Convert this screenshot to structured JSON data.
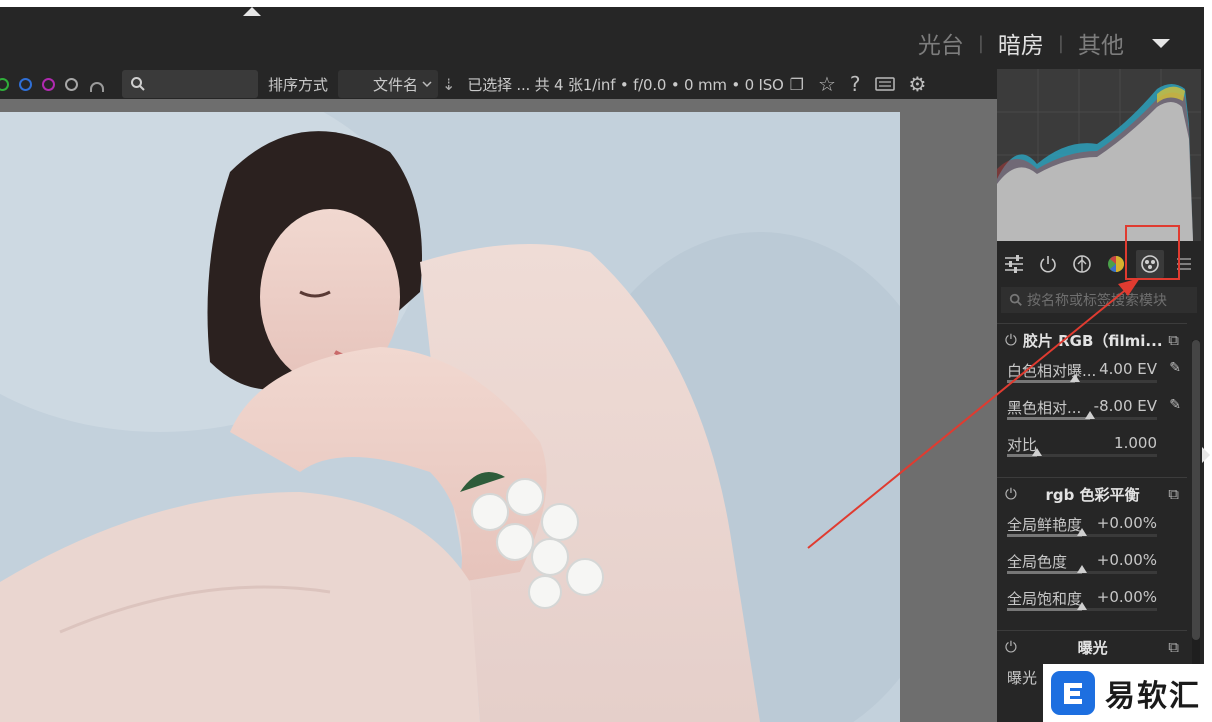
{
  "views": {
    "lighttable": "光台",
    "darkroom": "暗房",
    "other": "其他",
    "separator": "|"
  },
  "filter_bar": {
    "color_labels": [
      "green-circle",
      "blue-circle",
      "purple-circle",
      "gray-circle"
    ],
    "search_placeholder": "",
    "sort_label": "排序方式",
    "sort_value": "文件名",
    "status": "已选择 ... 共 4 张1/inf • f/0.0 • 0 mm • 0 ISO"
  },
  "module_search": {
    "placeholder": "按名称或标签搜索模块"
  },
  "modules": [
    {
      "title": "胶片 RGB（filmi...",
      "controls": [
        {
          "label": "白色相对曝...",
          "value": "4.00 EV",
          "level": 0.45
        },
        {
          "label": "黑色相对...",
          "value": "-8.00 EV",
          "level": 0.55
        },
        {
          "label": "对比",
          "value": "1.000",
          "level": 0.2
        }
      ]
    },
    {
      "title": "rgb 色彩平衡",
      "controls": [
        {
          "label": "全局鲜艳度",
          "value": "+0.00%",
          "level": 0.5
        },
        {
          "label": "全局色度",
          "value": "+0.00%",
          "level": 0.5
        },
        {
          "label": "全局饱和度",
          "value": "+0.00%",
          "level": 0.5
        }
      ]
    },
    {
      "title": "曝光",
      "controls": [
        {
          "label": "曝光",
          "value": ""
        }
      ]
    }
  ],
  "watermark": {
    "text": "易软汇"
  },
  "colors": {
    "panel": "#262626",
    "canvas": "#6e6e6e",
    "annotation": "#e03b30"
  }
}
